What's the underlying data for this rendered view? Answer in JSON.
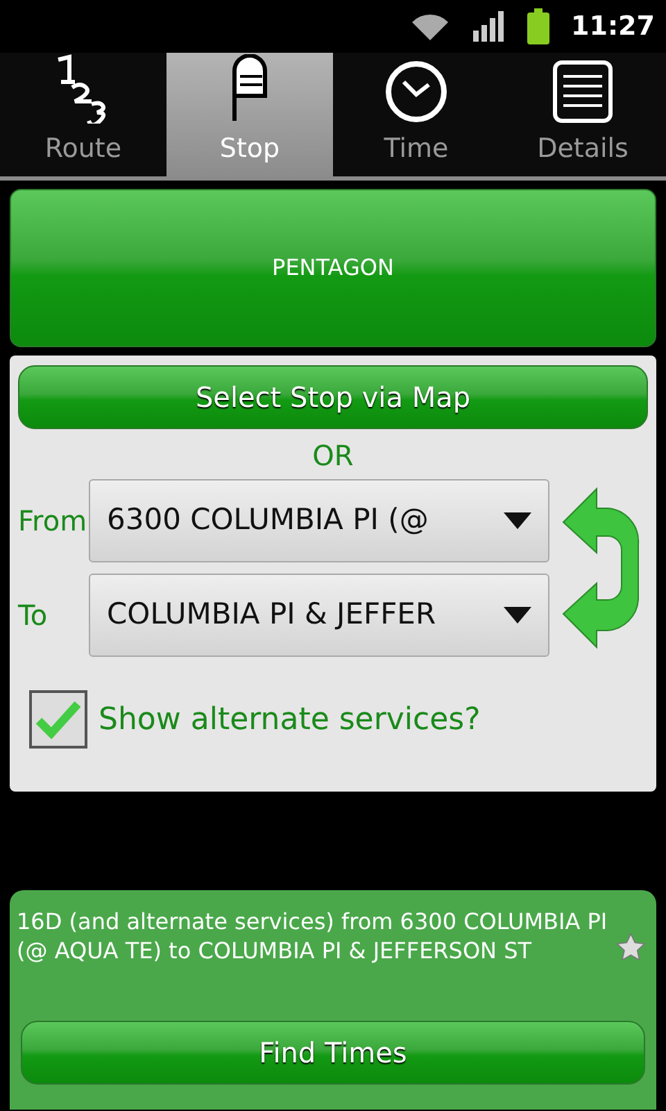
{
  "status_bar": {
    "time": "11:27"
  },
  "tabs": [
    {
      "label": "Route",
      "kind": "route",
      "selected": false
    },
    {
      "label": "Stop",
      "kind": "stop",
      "selected": true
    },
    {
      "label": "Time",
      "kind": "time",
      "selected": false
    },
    {
      "label": "Details",
      "kind": "details",
      "selected": false
    }
  ],
  "route_button": {
    "label": "PENTAGON"
  },
  "map_button": {
    "label": "Select Stop via Map"
  },
  "or_label": "OR",
  "from": {
    "label": "From",
    "value": "6300 COLUMBIA PI (@"
  },
  "to": {
    "label": "To",
    "value": "COLUMBIA PI & JEFFER"
  },
  "alternate_services": {
    "label": "Show alternate services?",
    "checked": true
  },
  "summary": {
    "text": "16D (and alternate services) from 6300 COLUMBIA PI (@ AQUA TE) to COLUMBIA PI & JEFFERSON ST"
  },
  "find_button": {
    "label": "Find Times"
  }
}
